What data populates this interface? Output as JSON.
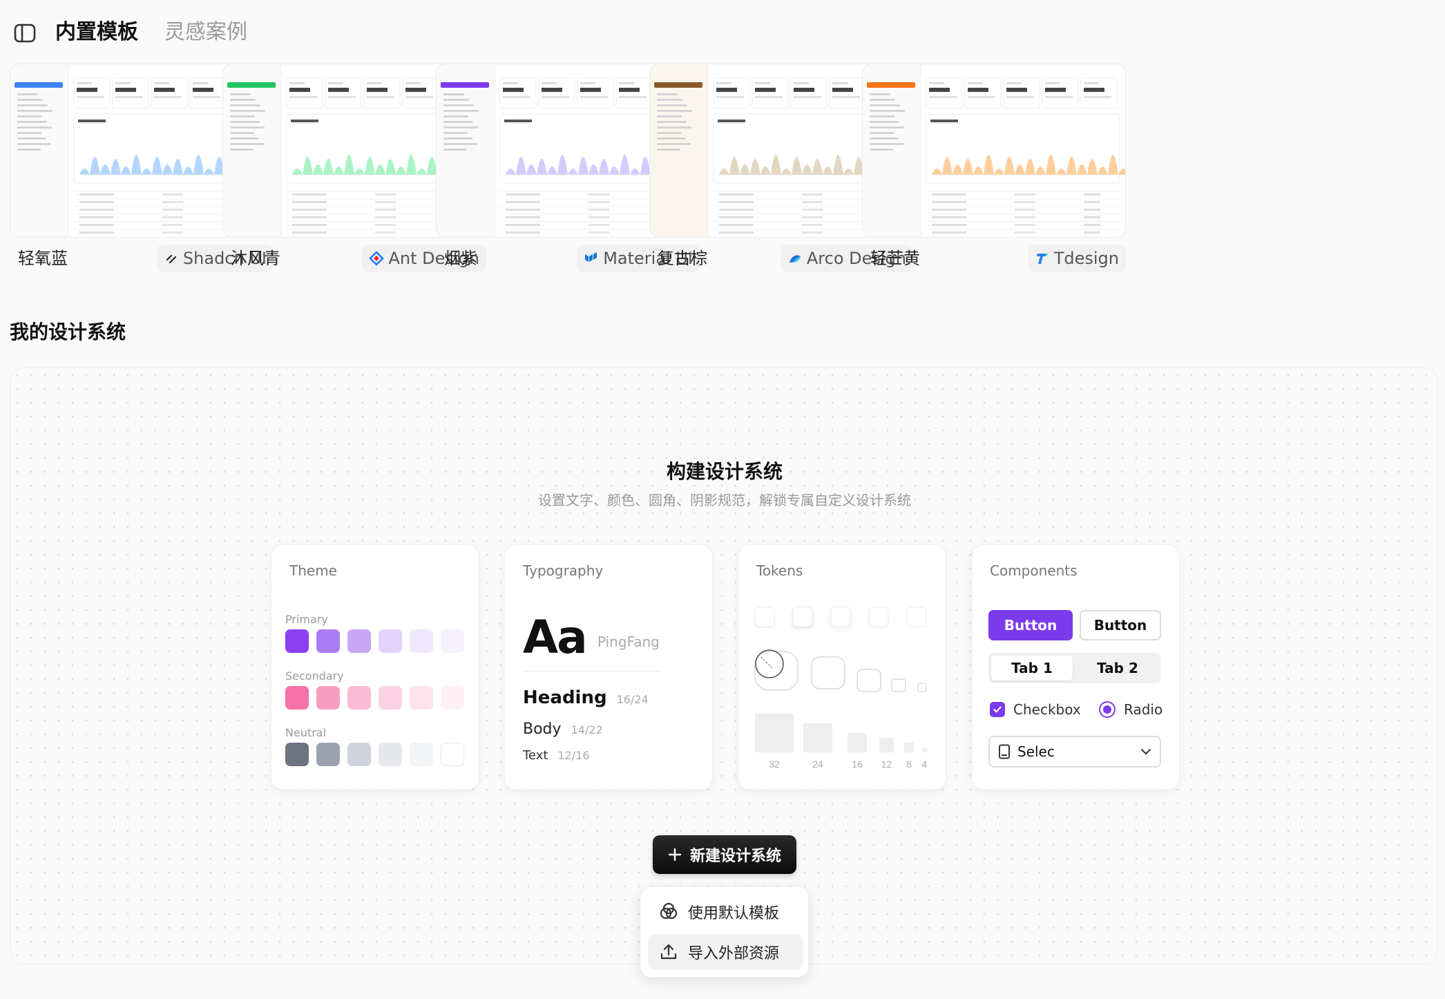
{
  "header": {
    "tabs": [
      {
        "label": "内置模板",
        "active": true
      },
      {
        "label": "灵感案例",
        "active": false
      }
    ]
  },
  "templates": [
    {
      "name": "轻氧蓝",
      "system": "Shadcn UI",
      "system_icon": "shadcn-icon",
      "accent": "#3b82f6",
      "chart_color": "#93c5fd"
    },
    {
      "name": "沐风青",
      "system": "Ant Design",
      "system_icon": "ant-design-icon",
      "accent": "#22c55e",
      "chart_color": "#86efac"
    },
    {
      "name": "烟紫",
      "system": "Material UI",
      "system_icon": "material-ui-icon",
      "accent": "#7c3aed",
      "chart_color": "#c4b5fd"
    },
    {
      "name": "复古棕",
      "system": "Arco Design",
      "system_icon": "arco-design-icon",
      "accent": "#8b5a2b",
      "chart_color": "#d6c7a8"
    },
    {
      "name": "轻芒黄",
      "system": "Tdesign",
      "system_icon": "tdesign-icon",
      "accent": "#f97316",
      "chart_color": "#fdba74"
    }
  ],
  "my_systems": {
    "title": "我的设计系统",
    "hero_title": "构建设计系统",
    "hero_subtitle": "设置文字、颜色、圆角、阴影规范，解锁专属自定义设计系统",
    "theme": {
      "title": "Theme",
      "primary_label": "Primary",
      "primary": [
        "#8b3ff0",
        "#a97ef5",
        "#c7a8f7",
        "#e2d3fb",
        "#efe7fd",
        "#f6f1fe"
      ],
      "secondary_label": "Secondary",
      "secondary": [
        "#f472a6",
        "#f79ec0",
        "#f9bcd4",
        "#fbd2e3",
        "#fde3ec",
        "#fef0f5"
      ],
      "neutral_label": "Neutral",
      "neutral": [
        "#6b7280",
        "#9ca3af",
        "#d1d5db",
        "#e5e7eb",
        "#f3f4f6",
        "#ffffff"
      ]
    },
    "typography": {
      "title": "Typography",
      "sample": "Aa",
      "font_name": "PingFang",
      "heading": "Heading",
      "heading_size": "16/24",
      "body": "Body",
      "body_size": "14/22",
      "text": "Text",
      "text_size": "12/16"
    },
    "tokens": {
      "title": "Tokens",
      "spacing_labels": [
        "32",
        "24",
        "16",
        "12",
        "8",
        "4"
      ]
    },
    "components": {
      "title": "Components",
      "primary_button": "Button",
      "secondary_button": "Button",
      "tab1": "Tab 1",
      "tab2": "Tab 2",
      "checkbox": "Checkbox",
      "radio": "Radio",
      "select": "Selec",
      "accent": "#7c3aed"
    },
    "new_button": "新建设计系统",
    "menu": [
      {
        "label": "使用默认模板",
        "icon": "template-icon"
      },
      {
        "label": "导入外部资源",
        "icon": "upload-icon",
        "highlighted": true
      }
    ]
  }
}
